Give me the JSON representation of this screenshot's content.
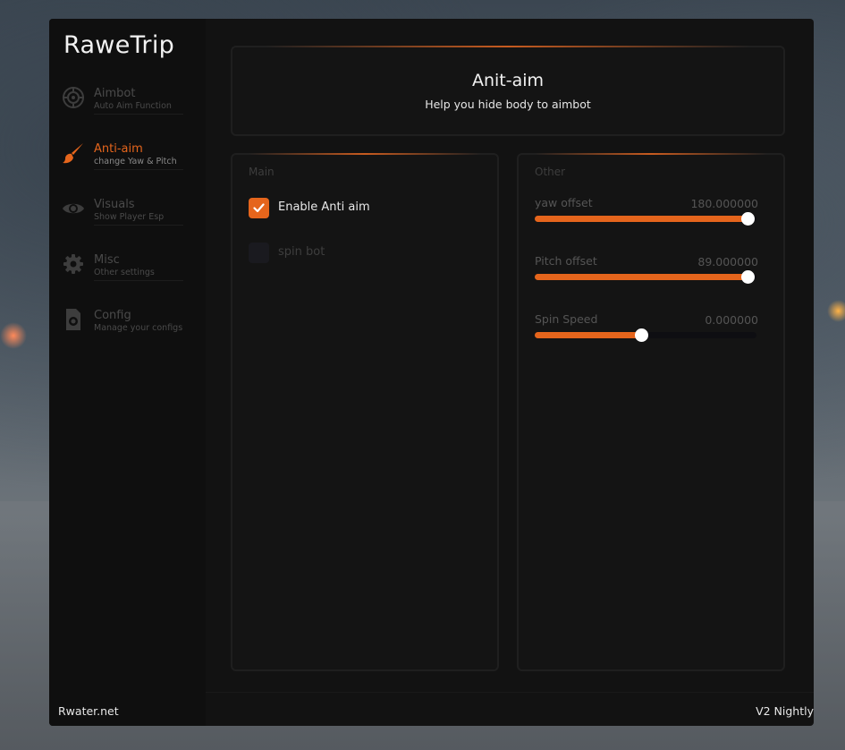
{
  "app": {
    "brand": "RaweTrip",
    "footer_left": "Rwater.net",
    "footer_right": "V2 Nightly",
    "accent_color": "#e5651c"
  },
  "sidebar": {
    "items": [
      {
        "title": "Aimbot",
        "subtitle": "Auto Aim Function",
        "icon": "crosshair-icon",
        "active": false
      },
      {
        "title": "Anti-aim",
        "subtitle": "change Yaw & Pitch",
        "icon": "brush-icon",
        "active": true
      },
      {
        "title": "Visuals",
        "subtitle": "Show Player Esp",
        "icon": "eye-icon",
        "active": false
      },
      {
        "title": "Misc",
        "subtitle": "Other settings",
        "icon": "gear-icon",
        "active": false
      },
      {
        "title": "Config",
        "subtitle": "Manage your configs",
        "icon": "config-file-icon",
        "active": false
      }
    ]
  },
  "header": {
    "title": "Anit-aim",
    "subtitle": "Help you hide body to aimbot"
  },
  "main_panel": {
    "label": "Main",
    "checkboxes": [
      {
        "label": "Enable Anti aim",
        "checked": true
      },
      {
        "label": "spin bot",
        "checked": false
      }
    ]
  },
  "other_panel": {
    "label": "Other",
    "sliders": [
      {
        "label": "yaw offset",
        "value": "180.000000",
        "fill_fraction": 0.96
      },
      {
        "label": "Pitch offset",
        "value": "89.000000",
        "fill_fraction": 0.96
      },
      {
        "label": "Spin Speed",
        "value": "0.000000",
        "fill_fraction": 0.48
      }
    ]
  }
}
